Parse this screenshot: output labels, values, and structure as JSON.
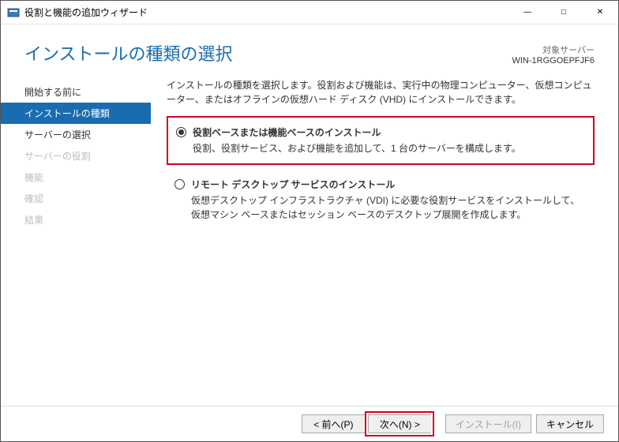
{
  "window": {
    "title": "役割と機能の追加ウィザード"
  },
  "header": {
    "page_title": "インストールの種類の選択",
    "server_label": "対象サーバー",
    "server_name": "WIN-1RGGOEPFJF6"
  },
  "sidebar": {
    "items": [
      {
        "label": "開始する前に",
        "state": "normal"
      },
      {
        "label": "インストールの種類",
        "state": "active"
      },
      {
        "label": "サーバーの選択",
        "state": "normal"
      },
      {
        "label": "サーバーの役割",
        "state": "disabled"
      },
      {
        "label": "機能",
        "state": "disabled"
      },
      {
        "label": "確認",
        "state": "disabled"
      },
      {
        "label": "結果",
        "state": "disabled"
      }
    ]
  },
  "main": {
    "instruction": "インストールの種類を選択します。役割および機能は、実行中の物理コンピューター、仮想コンピューター、またはオフラインの仮想ハード ディスク (VHD) にインストールできます。",
    "options": [
      {
        "title": "役割ベースまたは機能ベースのインストール",
        "desc": "役割、役割サービス、および機能を追加して、1 台のサーバーを構成します。",
        "checked": true,
        "highlight": true
      },
      {
        "title": "リモート デスクトップ サービスのインストール",
        "desc": "仮想デスクトップ インフラストラクチャ (VDI) に必要な役割サービスをインストールして、仮想マシン ベースまたはセッション ベースのデスクトップ展開を作成します。",
        "checked": false,
        "highlight": false
      }
    ]
  },
  "footer": {
    "prev": "< 前へ(P)",
    "next": "次へ(N) >",
    "install": "インストール(I)",
    "cancel": "キャンセル"
  }
}
